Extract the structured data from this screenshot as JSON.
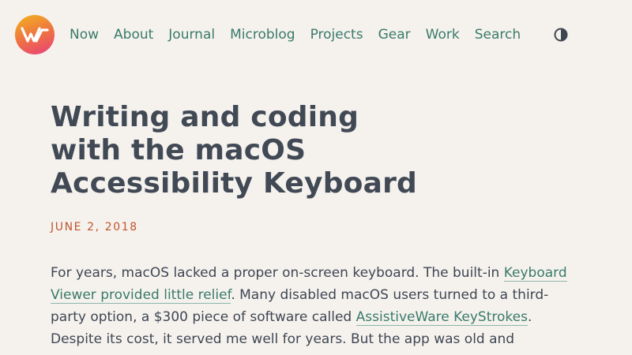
{
  "colors": {
    "background": "#f5f2ee",
    "nav_link": "#3a7a6a",
    "heading": "#414955",
    "date": "#c1552c",
    "logo_gradient": [
      "#f2b31f",
      "#ee6f45",
      "#e83f7c"
    ]
  },
  "header": {
    "logo_icon": "site-logo-icon",
    "nav": [
      {
        "label": "Now"
      },
      {
        "label": "About"
      },
      {
        "label": "Journal"
      },
      {
        "label": "Microblog"
      },
      {
        "label": "Projects"
      },
      {
        "label": "Gear"
      },
      {
        "label": "Work"
      },
      {
        "label": "Search"
      }
    ],
    "theme_toggle_icon": "contrast-toggle-icon"
  },
  "article": {
    "title_lines": [
      "Writing and coding",
      "with the macOS",
      "Accessibility Keyboard"
    ],
    "date": "JUNE 2, 2018",
    "para": {
      "t1": "For years, macOS lacked a proper on-screen keyboard. The built-in ",
      "link1": "Keyboard Viewer provided little relief",
      "t2": ". Many disabled macOS users turned to a third-party option, a $300 piece of software called ",
      "link2": "AssistiveWare KeyStrokes",
      "t3": ". Despite its cost, it served me well for years. But the app was old and"
    }
  }
}
